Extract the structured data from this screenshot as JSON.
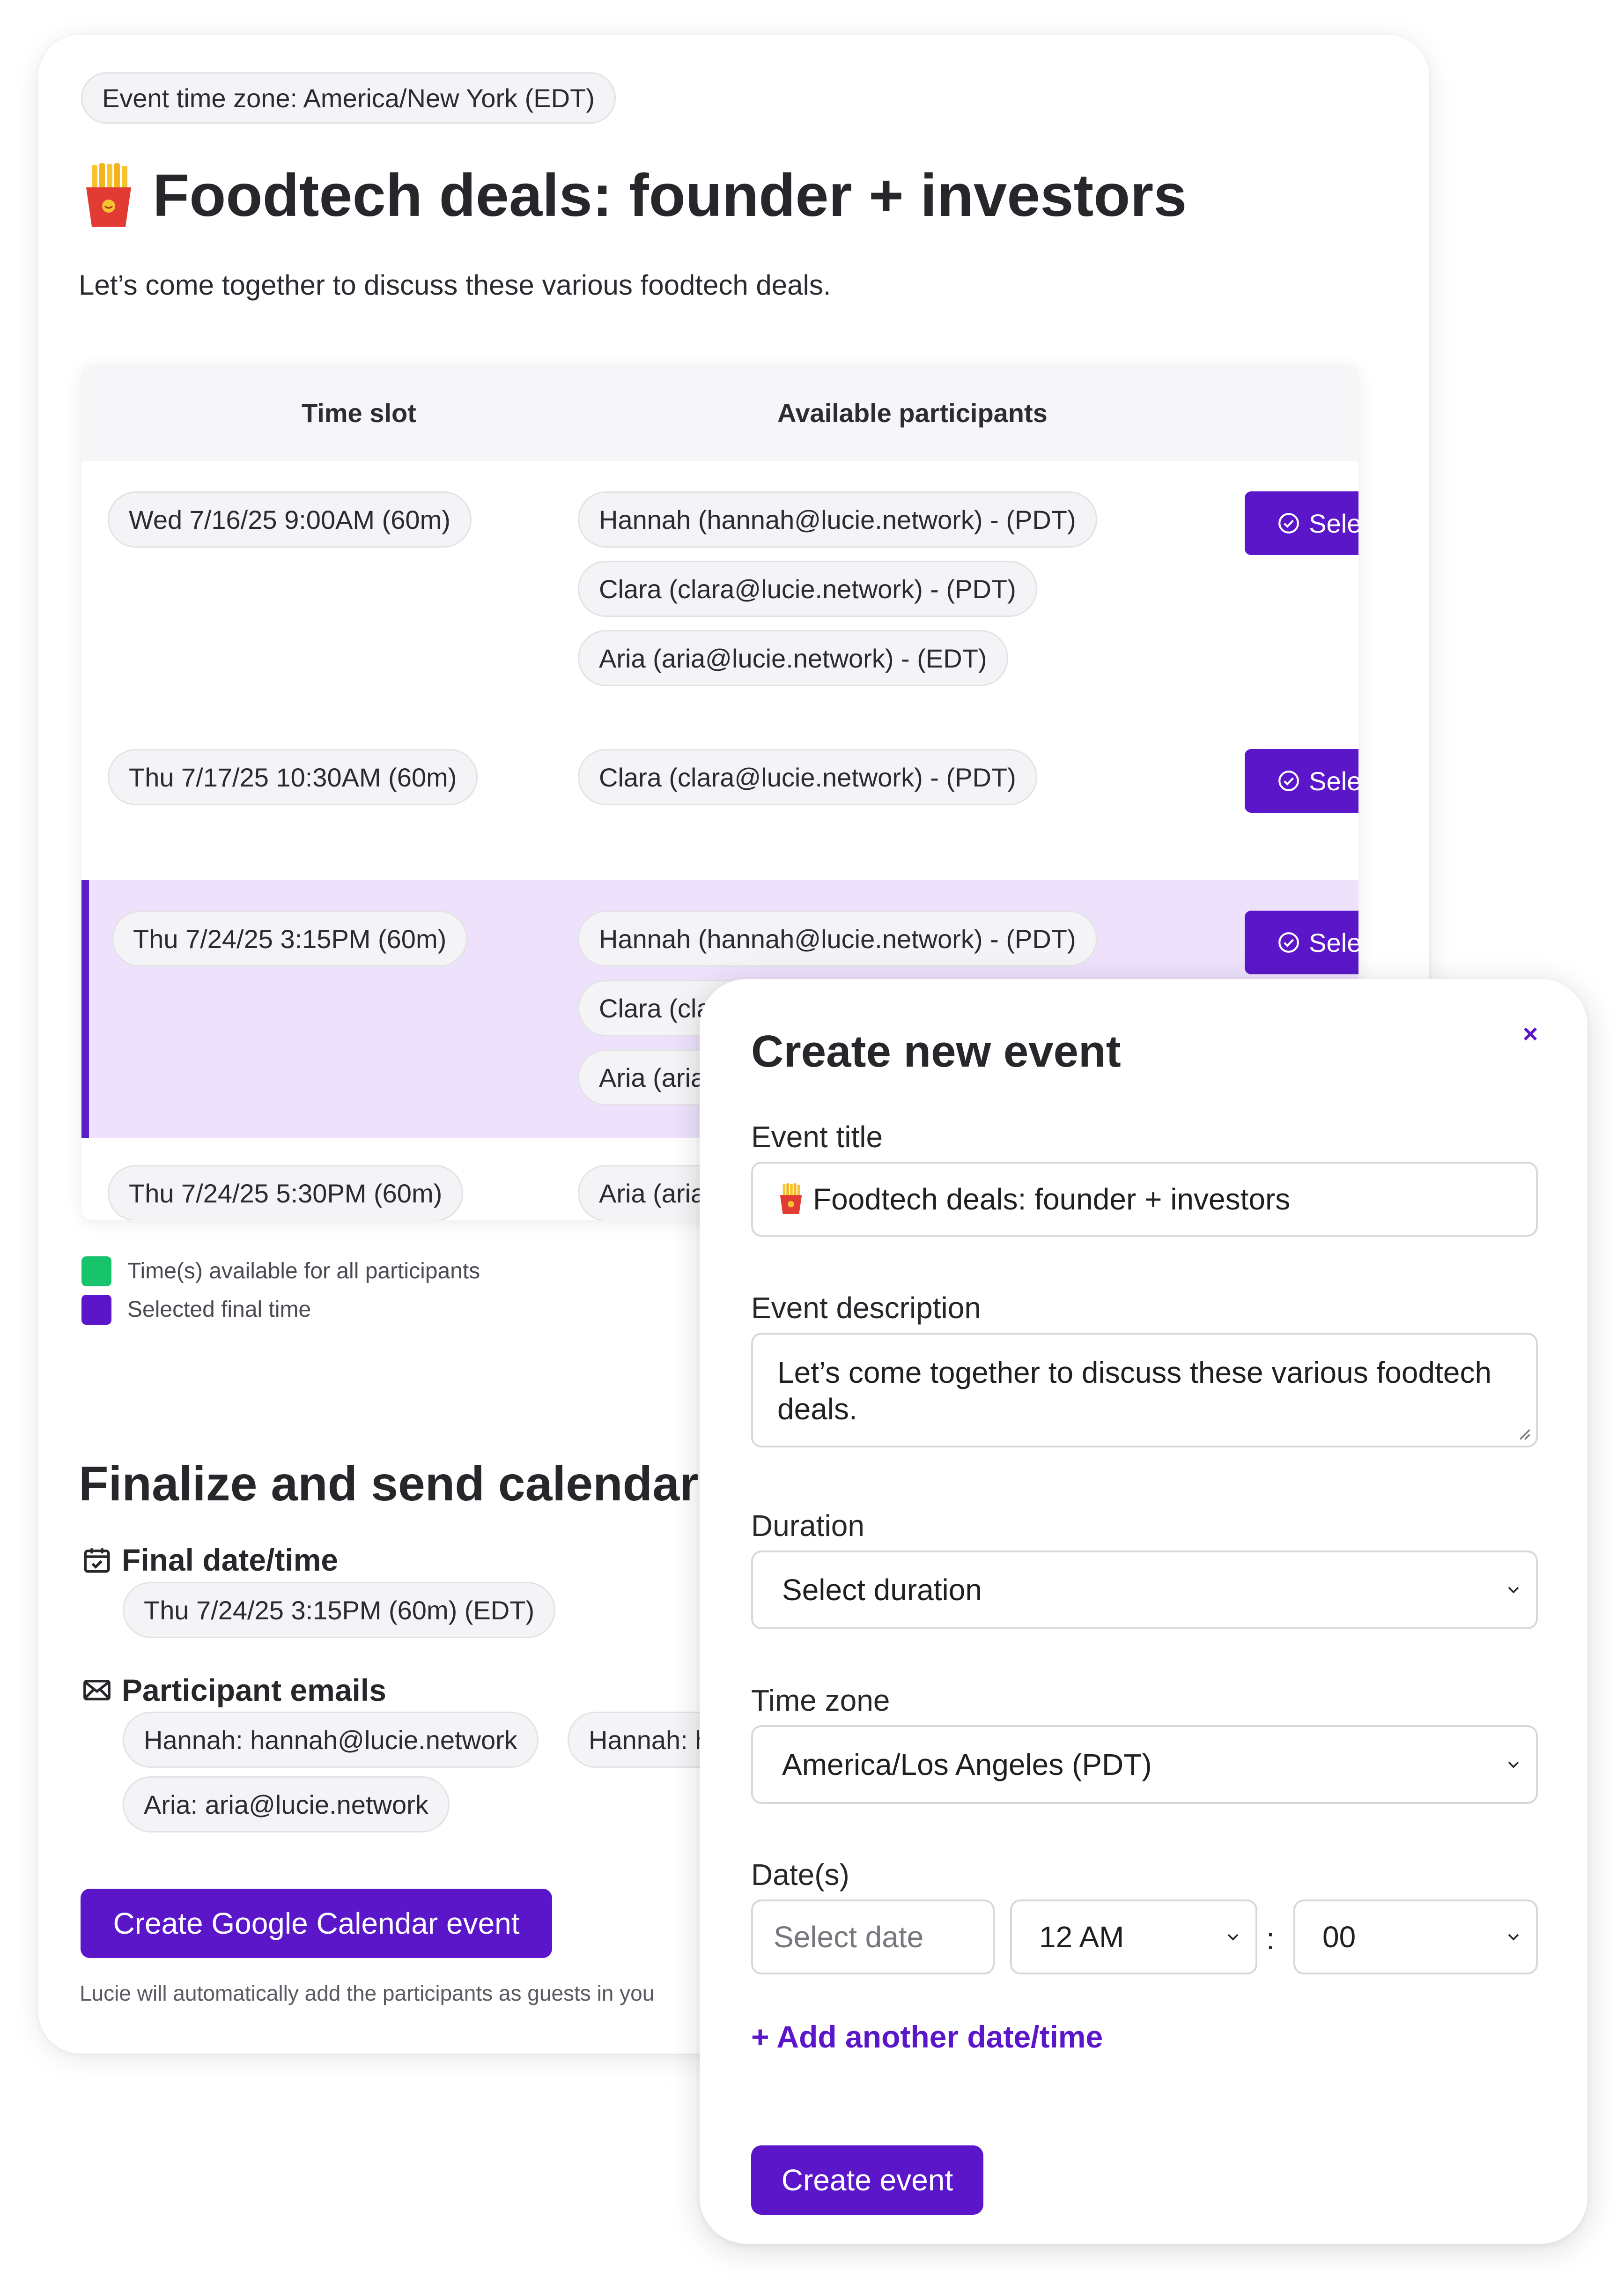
{
  "event": {
    "timezone_label": "Event time zone: America/New York (EDT)",
    "title": "Foodtech deals: founder + investors",
    "description": "Let’s come together to discuss these various foodtech deals."
  },
  "table": {
    "col_time": "Time slot",
    "col_participants": "Available participants",
    "select_label": "Select",
    "rows": [
      {
        "time": "Wed 7/16/25 9:00AM (60m)",
        "participants": [
          "Hannah (hannah@lucie.network) - (PDT)",
          "Clara (clara@lucie.network) - (PDT)",
          "Aria (aria@lucie.network) - (EDT)"
        ],
        "selected": false
      },
      {
        "time": "Thu 7/17/25 10:30AM (60m)",
        "participants": [
          "Clara (clara@lucie.network) - (PDT)"
        ],
        "selected": false
      },
      {
        "time": "Thu 7/24/25 3:15PM (60m)",
        "participants": [
          "Hannah (hannah@lucie.network) - (PDT)",
          "Clara (clara@lucie.network) - (PDT)",
          "Aria (aria"
        ],
        "selected": true
      },
      {
        "time": "Thu 7/24/25 5:30PM (60m)",
        "participants": [
          "Aria (aria"
        ],
        "selected": false
      }
    ]
  },
  "legend": [
    {
      "text": "Time(s) available for all participants",
      "color": "#17c36b"
    },
    {
      "text": "Selected final time",
      "color": "#5b16c9"
    }
  ],
  "finalize": {
    "heading": "Finalize and send calendar in",
    "final_label": "Final date/time",
    "final_value": "Thu 7/24/25 3:15PM (60m) (EDT)",
    "emails_label": "Participant emails",
    "emails": [
      "Hannah: hannah@lucie.network",
      "Hannah: h",
      "Aria: aria@lucie.network"
    ],
    "gcal_button": "Create Google Calendar event",
    "footnote": "Lucie will automatically add the participants as guests in you"
  },
  "modal": {
    "title": "Create new event",
    "close": "×",
    "event_title_label": "Event title",
    "event_title_value": "Foodtech deals: founder + investors",
    "description_label": "Event description",
    "description_value": "Let’s come together to discuss these various foodtech deals.",
    "duration_label": "Duration",
    "duration_value": "Select duration",
    "timezone_label": "Time zone",
    "timezone_value": "America/Los Angeles (PDT)",
    "dates_label": "Date(s)",
    "date_placeholder": "Select date",
    "hour_value": "12 AM",
    "time_separator": ":",
    "minute_value": "00",
    "add_link": "+ Add another date/time",
    "create_button": "Create event"
  },
  "colors": {
    "accent": "#5b16c9",
    "selected_row": "#ede1fb",
    "available": "#17c36b"
  }
}
